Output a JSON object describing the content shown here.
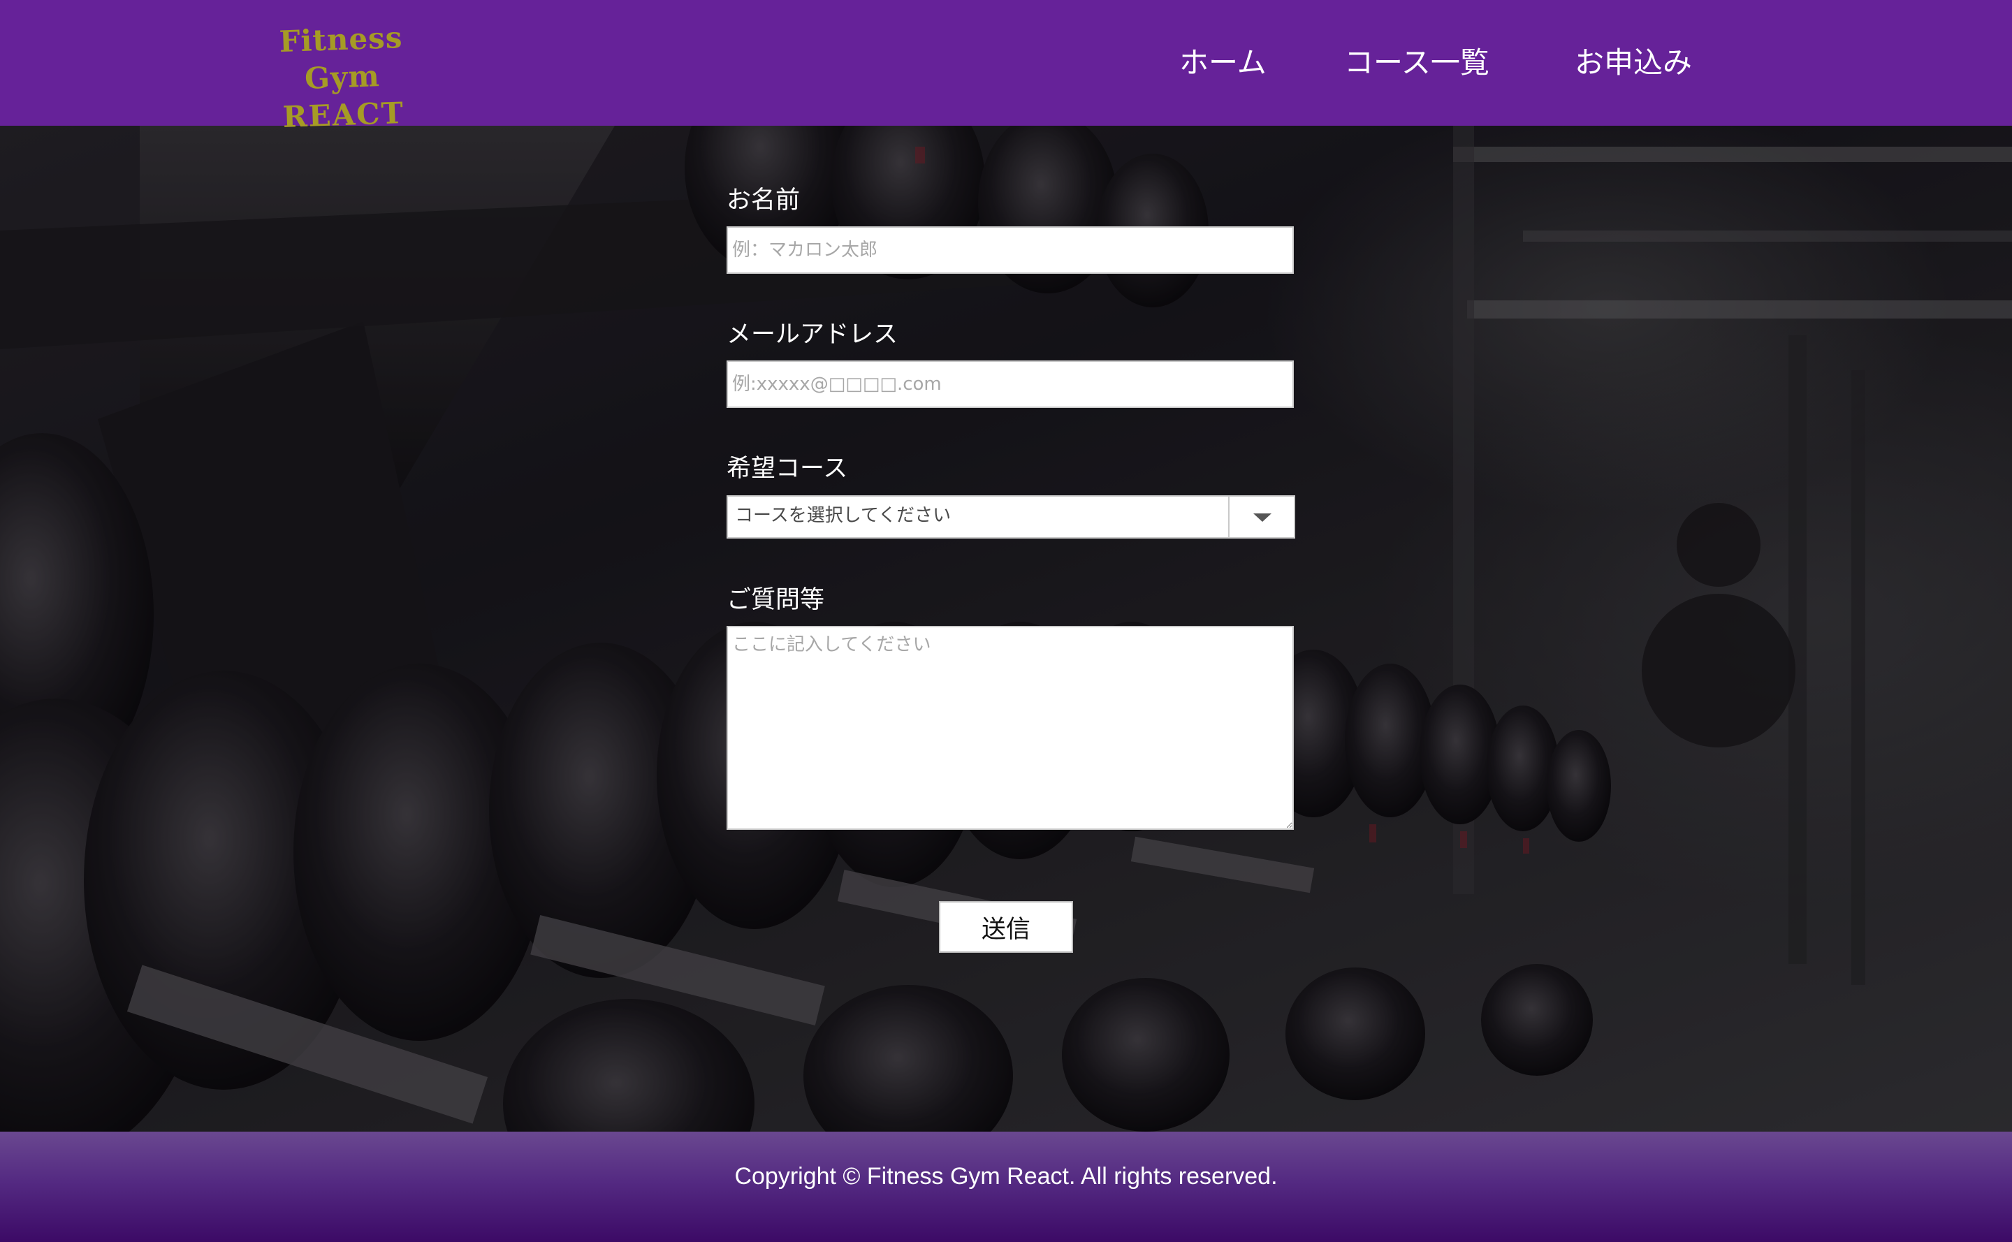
{
  "header": {
    "logo_line1": "Fitness Gym",
    "logo_line2": "REACT",
    "nav": [
      {
        "label": "ホーム"
      },
      {
        "label": "コース一覧"
      },
      {
        "label": "お申込み"
      }
    ]
  },
  "form": {
    "name_label": "お名前",
    "name_placeholder": "例：マカロン太郎",
    "email_label": "メールアドレス",
    "email_placeholder": "例:xxxxx@□□□□.com",
    "course_label": "希望コース",
    "course_selected": "コースを選択してください",
    "question_label": "ご質問等",
    "question_placeholder": "ここに記入してください",
    "submit_label": "送信"
  },
  "footer": {
    "copyright": "Copyright © Fitness Gym React. All rights reserved."
  },
  "colors": {
    "header_bg": "#662299",
    "logo_text": "#a69b25",
    "footer_bg": "#542a82"
  }
}
